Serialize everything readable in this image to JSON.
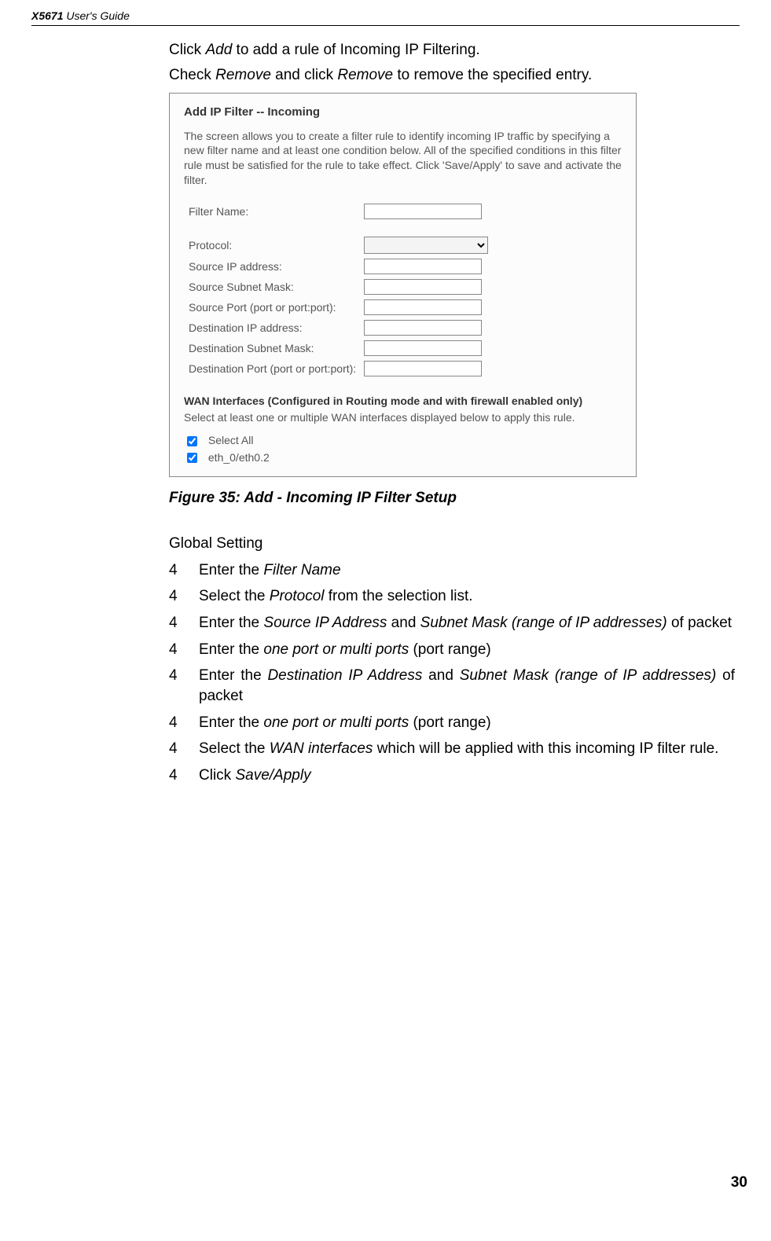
{
  "header": {
    "model": "X5671",
    "suffix": " User's Guide"
  },
  "intro": {
    "line1_a": "Click ",
    "line1_b": "Add",
    "line1_c": " to add a rule of Incoming IP Filtering.",
    "line2_a": "Check ",
    "line2_b": "Remove",
    "line2_c": " and click ",
    "line2_d": "Remove",
    "line2_e": " to remove the specified entry."
  },
  "shot": {
    "title": "Add IP Filter -- Incoming",
    "desc": "The screen allows you to create a filter rule to identify incoming IP traffic by specifying a new filter name and at least one condition below. All of the specified conditions in this filter rule must be satisfied for the rule to take effect. Click 'Save/Apply' to save and activate the filter.",
    "labels": {
      "filter_name": "Filter Name:",
      "protocol": "Protocol:",
      "src_ip": "Source IP address:",
      "src_mask": "Source Subnet Mask:",
      "src_port": "Source Port (port or port:port):",
      "dst_ip": "Destination IP address:",
      "dst_mask": "Destination Subnet Mask:",
      "dst_port": "Destination Port (port or port:port):"
    },
    "wan_title": "WAN Interfaces (Configured in Routing mode and with firewall enabled only)",
    "wan_desc": "Select at least one or multiple WAN interfaces displayed below to apply this rule.",
    "cb1": "Select All",
    "cb2": "eth_0/eth0.2"
  },
  "figure_caption": "Figure 35: Add - Incoming IP Filter Setup",
  "global_label": "Global Setting",
  "steps": [
    {
      "n": "4",
      "pre": "Enter the ",
      "it": "Filter Name",
      "post": ""
    },
    {
      "n": "4",
      "pre": "Select the ",
      "it": "Protocol",
      "post": " from the selection list."
    },
    {
      "n": "4",
      "pre": "Enter the ",
      "it": "Source IP Address",
      "mid": " and ",
      "it2": "Subnet Mask (range of IP addresses)",
      "post": " of packet"
    },
    {
      "n": "4",
      "pre": "Enter the ",
      "it": "one port or multi ports",
      "post": " (port range)"
    },
    {
      "n": "4",
      "pre": "Enter the ",
      "it": "Destination IP Address",
      "mid": " and ",
      "it2": "Subnet Mask (range of IP addresses)",
      "post": " of packet"
    },
    {
      "n": "4",
      "pre": "Enter the ",
      "it": "one port or multi ports",
      "post": " (port range)"
    },
    {
      "n": "4",
      "pre": "Select the ",
      "it": "WAN interfaces",
      "post": " which will be applied with this incoming IP filter rule."
    },
    {
      "n": "4",
      "pre": "Click ",
      "it": "Save/Apply",
      "post": ""
    }
  ],
  "page_number": "30"
}
